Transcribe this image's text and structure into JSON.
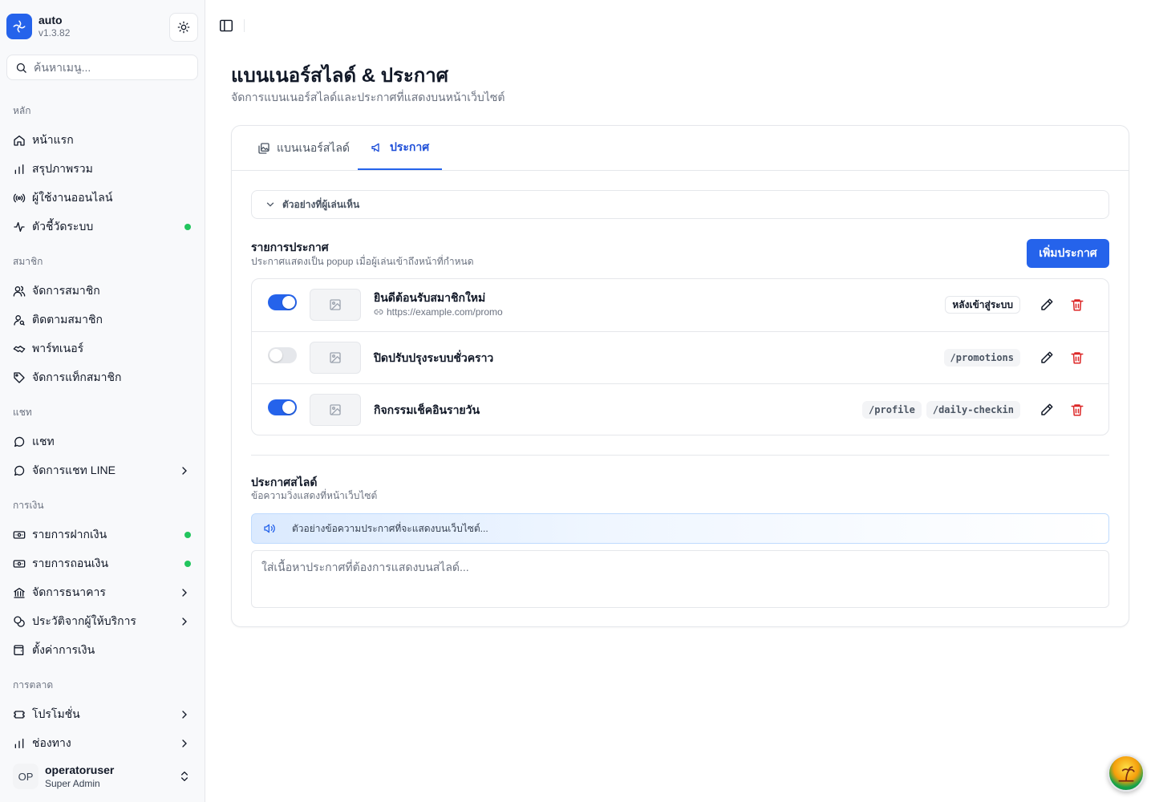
{
  "app": {
    "name": "auto",
    "version": "v1.3.82"
  },
  "search": {
    "placeholder": "ค้นหาเมนู..."
  },
  "sidebar": {
    "groups": [
      {
        "label": "หลัก",
        "items": [
          {
            "label": "หน้าแรก",
            "icon": "home-icon"
          },
          {
            "label": "สรุปภาพรวม",
            "icon": "bar-chart-icon"
          },
          {
            "label": "ผู้ใช้งานออนไลน์",
            "icon": "radio-icon"
          },
          {
            "label": "ตัวชี้วัดระบบ",
            "icon": "activity-icon",
            "status_dot": true
          }
        ]
      },
      {
        "label": "สมาชิก",
        "items": [
          {
            "label": "จัดการสมาชิก",
            "icon": "users-icon"
          },
          {
            "label": "ติดตามสมาชิก",
            "icon": "user-search-icon"
          },
          {
            "label": "พาร์ทเนอร์",
            "icon": "handshake-icon"
          },
          {
            "label": "จัดการแท็กสมาชิก",
            "icon": "tag-icon"
          }
        ]
      },
      {
        "label": "แชท",
        "items": [
          {
            "label": "แชท",
            "icon": "chat-icon"
          },
          {
            "label": "จัดการแชท LINE",
            "icon": "chat-icon",
            "expandable": true
          }
        ]
      },
      {
        "label": "การเงิน",
        "items": [
          {
            "label": "รายการฝากเงิน",
            "icon": "deposit-icon",
            "status_dot": true
          },
          {
            "label": "รายการถอนเงิน",
            "icon": "withdraw-icon",
            "status_dot": true
          },
          {
            "label": "จัดการธนาคาร",
            "icon": "bank-icon",
            "expandable": true
          },
          {
            "label": "ประวัติจากผู้ให้บริการ",
            "icon": "coins-icon",
            "expandable": true
          },
          {
            "label": "ตั้งค่าการเงิน",
            "icon": "wallet-icon"
          }
        ]
      },
      {
        "label": "การตลาด",
        "items": [
          {
            "label": "โปรโมชั่น",
            "icon": "ticket-icon",
            "expandable": true
          },
          {
            "label": "ช่องทาง",
            "icon": "bar-chart-icon",
            "expandable": true
          }
        ]
      }
    ]
  },
  "user": {
    "initials": "OP",
    "name": "operatoruser",
    "role": "Super Admin"
  },
  "page": {
    "title": "แบนเนอร์สไลด์ & ประกาศ",
    "subtitle": "จัดการแบนเนอร์สไลด์และประกาศที่แสดงบนหน้าเว็บไซต์"
  },
  "tabs": [
    {
      "label": "แบนเนอร์สไลด์",
      "active": false
    },
    {
      "label": "ประกาศ",
      "active": true
    }
  ],
  "preview": {
    "label": "ตัวอย่างที่ผู้เล่นเห็น"
  },
  "announcements": {
    "title": "รายการประกาศ",
    "subtitle": "ประกาศแสดงเป็น popup เมื่อผู้เล่นเข้าถึงหน้าที่กำหนด",
    "add_label": "เพิ่มประกาศ",
    "items": [
      {
        "title": "ยินดีต้อนรับสมาชิกใหม่",
        "link": "https://example.com/promo",
        "enabled": true,
        "badges": [
          {
            "text": "หลังเข้าสู่ระบบ",
            "style": "outline"
          }
        ]
      },
      {
        "title": "ปิดปรับปรุงระบบชั่วคราว",
        "link": "",
        "enabled": false,
        "badges": [
          {
            "text": "/promotions",
            "style": "code"
          }
        ]
      },
      {
        "title": "กิจกรรมเช็คอินรายวัน",
        "link": "",
        "enabled": true,
        "badges": [
          {
            "text": "/profile",
            "style": "code"
          },
          {
            "text": "/daily-checkin",
            "style": "code"
          }
        ]
      }
    ]
  },
  "slide_announcement": {
    "title": "ประกาศสไลด์",
    "subtitle": "ข้อความวิ่งแสดงที่หน้าเว็บไซต์",
    "preview_text": "ตัวอย่างข้อความประกาศที่จะแสดงบนเว็บไซต์...",
    "input_placeholder": "ใส่เนื้อหาประกาศที่ต้องการแสดงบนสไลด์..."
  },
  "colors": {
    "accent": "#2563eb",
    "status_dot": "#22c55e",
    "danger": "#dc2626"
  }
}
